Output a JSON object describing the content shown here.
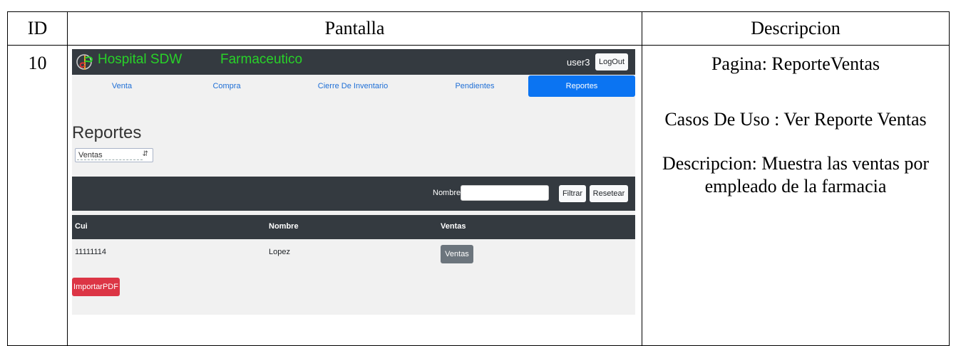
{
  "table": {
    "headers": {
      "id": "ID",
      "pantalla": "Pantalla",
      "descripcion": "Descripcion"
    },
    "row": {
      "id": "10",
      "descripcion": {
        "pagina": "Pagina: ReporteVentas",
        "casos": "Casos De Uso : Ver Reporte Ventas",
        "detalle": "Descripcion: Muestra las ventas por empleado de la farmacia"
      }
    }
  },
  "screen": {
    "brand": "Hospital SDW",
    "section": "Farmaceutico",
    "user": "user3",
    "logout_label": "LogOut",
    "nav": [
      {
        "label": "Venta",
        "active": false
      },
      {
        "label": "Compra",
        "active": false
      },
      {
        "label": "Cierre De Inventario",
        "active": false
      },
      {
        "label": "Pendientes",
        "active": false
      },
      {
        "label": "Reportes",
        "active": true
      }
    ],
    "page_title": "Reportes",
    "report_select": {
      "selected": "Ventas"
    },
    "filter": {
      "label": "Nombre:",
      "value": "",
      "filter_button": "Filtrar",
      "reset_button": "Resetear"
    },
    "results_table": {
      "columns": [
        "Cui",
        "Nombre",
        "Ventas"
      ],
      "rows": [
        {
          "cui": "11111114",
          "nombre": "Lopez",
          "action": "Ventas"
        }
      ]
    },
    "export_button": "ImportarPDF",
    "colors": {
      "dark": "#343a40",
      "brand_green": "#28d228",
      "active_tab": "#0b74f2",
      "danger": "#dc3545",
      "secondary": "#6c757d"
    }
  }
}
